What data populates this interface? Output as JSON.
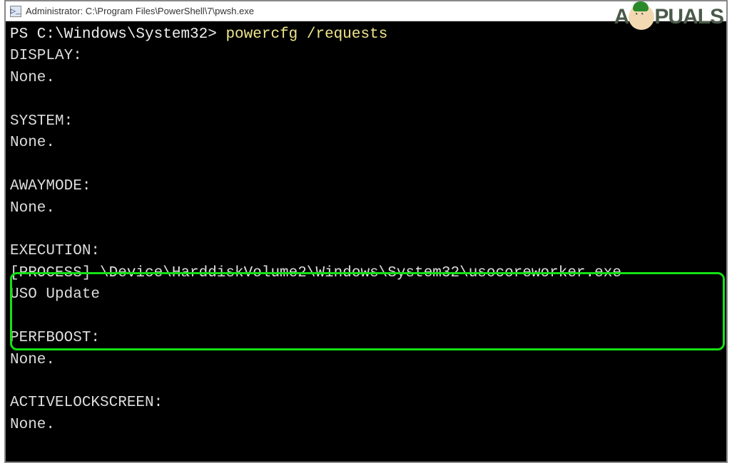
{
  "window": {
    "icon_glyph": "▷_",
    "title": "Administrator: C:\\Program Files\\PowerShell\\7\\pwsh.exe"
  },
  "terminal": {
    "prompt": "PS C:\\Windows\\System32> ",
    "command": "powercfg /requests",
    "sections": {
      "display": {
        "label": "DISPLAY:",
        "value": "None."
      },
      "system": {
        "label": "SYSTEM:",
        "value": "None."
      },
      "awaymode": {
        "label": "AWAYMODE:",
        "value": "None."
      },
      "execution": {
        "label": "EXECUTION:",
        "line1": "[PROCESS] \\Device\\HarddiskVolume2\\Windows\\System32\\usocoreworker.exe",
        "line2": "USO Update"
      },
      "perfboost": {
        "label": "PERFBOOST:",
        "value": "None."
      },
      "activelockscreen": {
        "label": "ACTIVELOCKSCREEN:",
        "value": "None."
      }
    }
  },
  "watermark": {
    "left": "A",
    "right": "PUALS"
  }
}
